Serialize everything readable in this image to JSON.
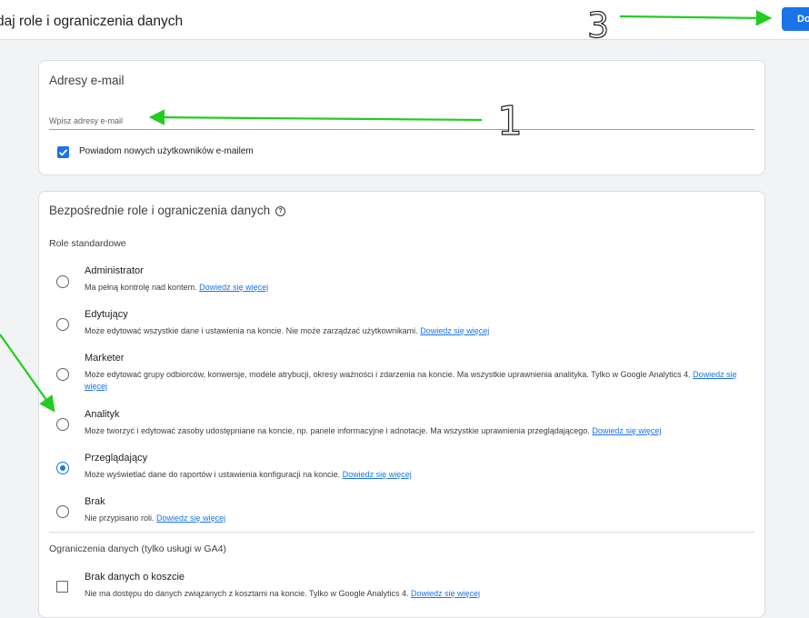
{
  "header": {
    "title": "daj role i ograniczenia danych",
    "add_button": "Dodaj"
  },
  "email_card": {
    "title": "Adresy e-mail",
    "input_placeholder": "Wpisz adresy e-mail",
    "input_value": "",
    "notify_label": "Powiadom nowych użytkowników e-mailem",
    "notify_checked": true
  },
  "roles_card": {
    "title": "Bezpośrednie role i ograniczenia danych",
    "standard_roles_label": "Role standardowe",
    "roles": [
      {
        "name": "Administrator",
        "desc": "Ma pełną kontrolę nad kontem.",
        "link": "Dowiedz się więcej",
        "selected": false
      },
      {
        "name": "Edytujący",
        "desc": "Może edytować wszystkie dane i ustawienia na koncie. Nie może zarządzać użytkownikami.",
        "link": "Dowiedz się więcej",
        "selected": false
      },
      {
        "name": "Marketer",
        "desc": "Może edytować grupy odbiorców, konwersje, modele atrybucji, okresy ważności i zdarzenia na koncie. Ma wszystkie uprawnienia analityka. Tylko w Google Analytics 4.",
        "link": "Dowiedz się więcej",
        "selected": false
      },
      {
        "name": "Analityk",
        "desc": "Może tworzyć i edytować zasoby udostępniane na koncie, np. panele informacyjne i adnotacje. Ma wszystkie uprawnienia przeglądającego.",
        "link": "Dowiedz się więcej",
        "selected": false
      },
      {
        "name": "Przeglądający",
        "desc": "Może wyświetlać dane do raportów i ustawienia konfiguracji na koncie.",
        "link": "Dowiedz się więcej",
        "selected": true
      },
      {
        "name": "Brak",
        "desc": "Nie przypisano roli.",
        "link": "Dowiedz się więcej",
        "selected": false
      }
    ],
    "data_restrictions_label": "Ograniczenia danych (tylko usługi w GA4)",
    "restrictions": [
      {
        "name": "Brak danych o koszcie",
        "desc": "Nie ma dostępu do danych związanych z kosztami na koncie. Tylko w Google Analytics 4.",
        "link": "Dowiedz się więcej",
        "checked": false
      }
    ]
  },
  "annotations": {
    "step1": "1",
    "step3": "3",
    "arrow_color": "#22cc22"
  }
}
